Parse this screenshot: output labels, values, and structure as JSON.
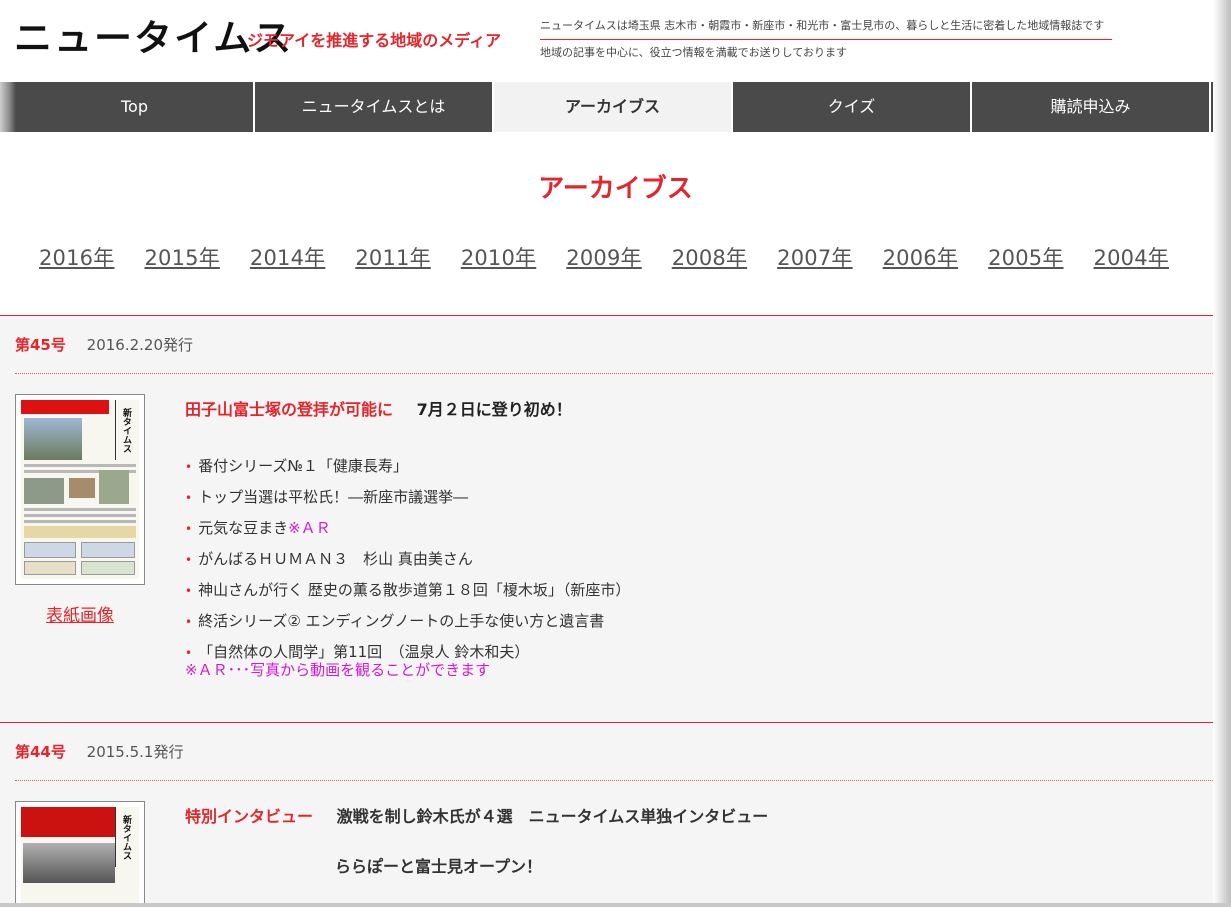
{
  "header": {
    "logo": "ニュータイムス",
    "tagline": "ジモアイを推進する地域のメディア",
    "description_line1": "ニュータイムスは埼玉県 志木市・朝霞市・新座市・和光市・富士見市の、暮らしと生活に密着した地域情報誌です",
    "description_line2": "地域の記事を中心に、役立つ情報を満載でお送りしております"
  },
  "nav": {
    "items": [
      {
        "label": "Top"
      },
      {
        "label": "ニュータイムスとは"
      },
      {
        "label": "アーカイブス"
      },
      {
        "label": "クイズ"
      },
      {
        "label": "購読申込み"
      }
    ],
    "active": "アーカイブス"
  },
  "page_title": "アーカイブス",
  "years": [
    "2016年",
    "2015年",
    "2014年",
    "2011年",
    "2010年",
    "2009年",
    "2008年",
    "2007年",
    "2006年",
    "2005年",
    "2004年"
  ],
  "issues": [
    {
      "number": "第45号",
      "date": "2016.2.20発行",
      "cover_link": "表紙画像",
      "cover_logo": "新タイムス",
      "headline_red": "田子山富士塚の登拝が可能に",
      "headline_black": "7月２日に登り初め！",
      "items": [
        {
          "text": "番付シリーズ№１「健康長寿」",
          "ar": ""
        },
        {
          "text": "トップ当選は平松氏！―新座市議選挙―",
          "ar": ""
        },
        {
          "text": "元気な豆まき",
          "ar": "※ＡＲ"
        },
        {
          "text": "がんばるＨＵＭＡＮ３　杉山 真由美さん",
          "ar": ""
        },
        {
          "text": "神山さんが行く 歴史の薫る散歩道第１８回「榎木坂」（新座市）",
          "ar": ""
        },
        {
          "text": "終活シリーズ② エンディングノートの上手な使い方と遺言書",
          "ar": ""
        },
        {
          "text": "「自然体の人間学」第11回　（温泉人 鈴木和夫）",
          "ar": ""
        }
      ],
      "ar_note": "※ＡＲ･･･写真から動画を観ることができます"
    },
    {
      "number": "第44号",
      "date": "2015.5.1発行",
      "cover_logo": "新タイムス",
      "headline_red": "特別インタビュー",
      "headline_black": "激戦を制し鈴木氏が４選　ニュータイムス単独インタビュー",
      "sub_headline": "ららぽーと富士見オープン！"
    }
  ],
  "colors": {
    "accent": "#e3262b",
    "nav_bg": "#4a4a4a",
    "ar": "#d11bd1",
    "section_bg": "#f5f5f5"
  }
}
